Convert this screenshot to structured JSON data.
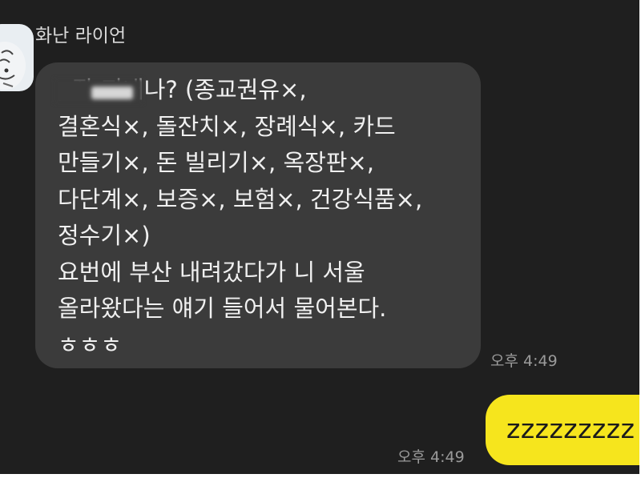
{
  "chat": {
    "incoming": {
      "sender_name": "화난 라이언",
      "avatar_icon": "ryan-character-avatar",
      "message": ", 잘 지내나? (종교권유×,\n결혼식×, 돌잔치×, 장례식×, 카드\n만들기×, 돈 빌리기×, 옥장판×,\n다단계×, 보증×, 보험×, 건강식품×,\n정수기×)\n요번에 부산 내려갔다가 니 서울\n올라왔다는 얘기 들어서 물어본다.\nㅎㅎㅎ",
      "time": "오후 4:49",
      "bubble_color": "#3b3b3b"
    },
    "outgoing": {
      "message": "zzzzzzzzz",
      "time": "오후 4:49",
      "bubble_color": "#f6e51d"
    },
    "background_color": "#1f1f1f"
  }
}
